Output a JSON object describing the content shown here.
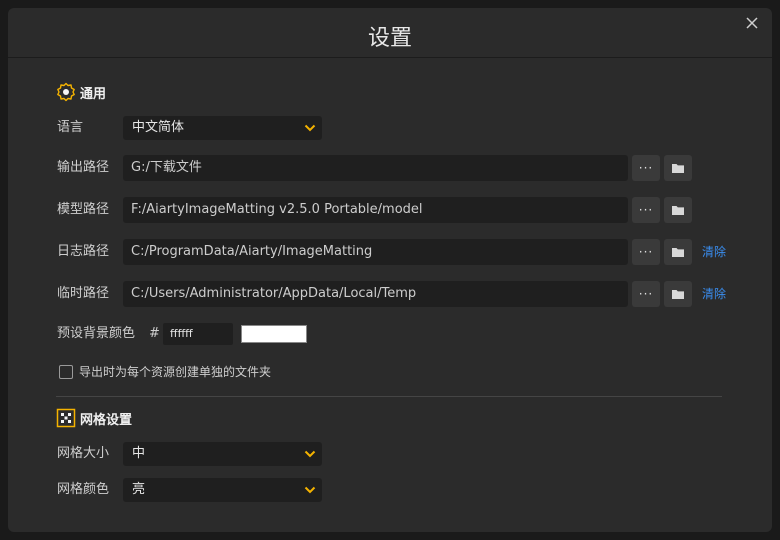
{
  "title": "设置",
  "general": {
    "heading": "通用",
    "language_label": "语言",
    "language_value": "中文简体",
    "output_label": "输出路径",
    "output_value": "G:/下载文件",
    "model_label": "模型路径",
    "model_value": "F:/AiartyImageMatting v2.5.0 Portable/model",
    "log_label": "日志路径",
    "log_value": "C:/ProgramData/Aiarty/ImageMatting",
    "temp_label": "临时路径",
    "temp_value": "C:/Users/Administrator/AppData/Local/Temp",
    "more_label": "···",
    "clear_label": "清除",
    "bg_label": "预设背景颜色",
    "bg_hash": "#",
    "bg_hex": "ffffff",
    "bg_color": "#ffffff",
    "folder_checkbox_label": "导出时为每个资源创建单独的文件夹",
    "folder_checkbox_checked": false
  },
  "grid": {
    "heading": "网格设置",
    "size_label": "网格大小",
    "size_value": "中",
    "color_label": "网格颜色",
    "color_value": "亮"
  },
  "colors": {
    "accent": "#f5b300",
    "link": "#3a8ef0",
    "background": "#2b2b2b"
  }
}
